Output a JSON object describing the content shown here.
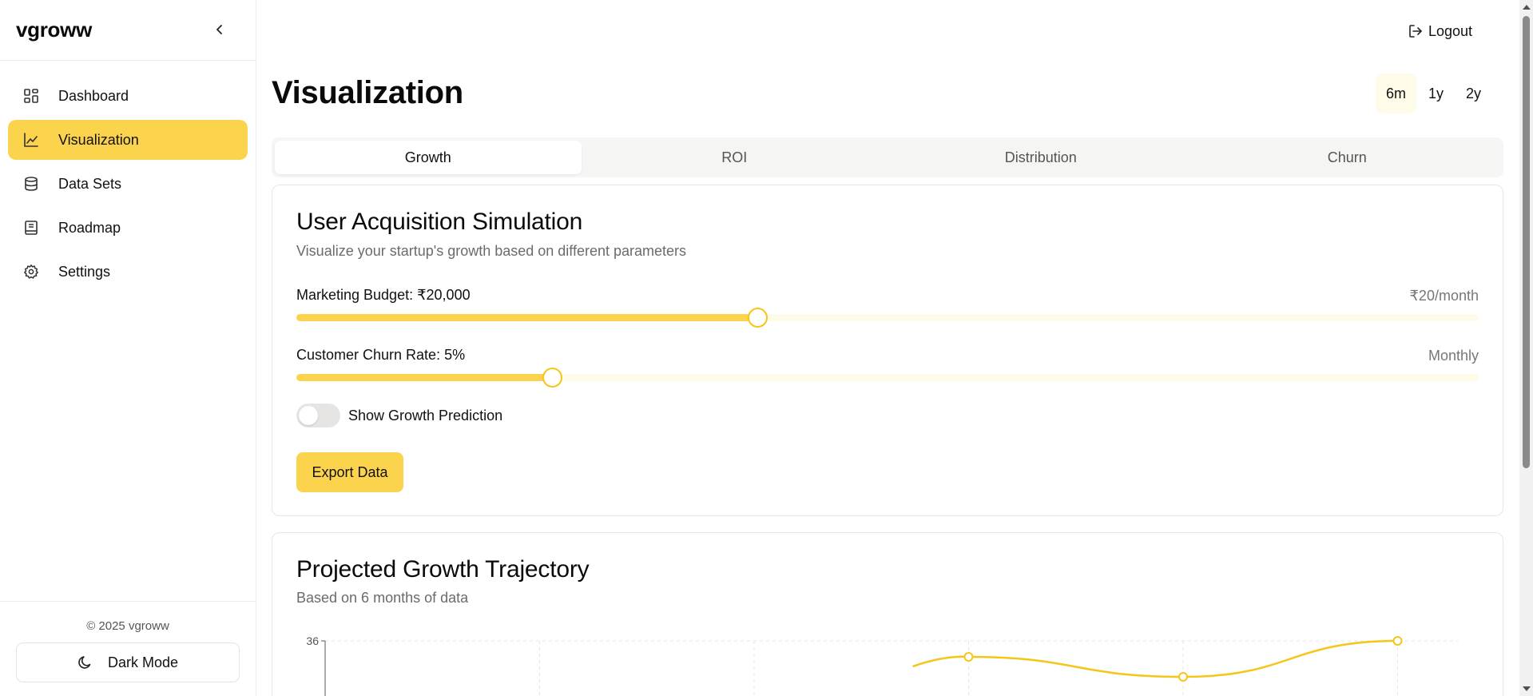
{
  "brand": "vgroww",
  "nav": [
    {
      "label": "Dashboard",
      "icon": "dashboard-grid-icon",
      "active": false
    },
    {
      "label": "Visualization",
      "icon": "line-chart-icon",
      "active": true
    },
    {
      "label": "Data Sets",
      "icon": "database-icon",
      "active": false
    },
    {
      "label": "Roadmap",
      "icon": "book-icon",
      "active": false
    },
    {
      "label": "Settings",
      "icon": "gear-icon",
      "active": false
    }
  ],
  "footer": {
    "copyright": "© 2025 vgroww",
    "dark_mode_label": "Dark Mode"
  },
  "header": {
    "logout_label": "Logout"
  },
  "page_title": "Visualization",
  "ranges": [
    {
      "label": "6m",
      "active": true
    },
    {
      "label": "1y",
      "active": false
    },
    {
      "label": "2y",
      "active": false
    }
  ],
  "tabs": [
    {
      "label": "Growth",
      "active": true
    },
    {
      "label": "ROI",
      "active": false
    },
    {
      "label": "Distribution",
      "active": false
    },
    {
      "label": "Churn",
      "active": false
    }
  ],
  "simulation": {
    "title": "User Acquisition Simulation",
    "subtitle": "Visualize your startup's growth based on different parameters",
    "budget_label": "Marketing Budget: ₹20,000",
    "budget_note": "₹20/month",
    "budget_fraction": 0.39,
    "churn_label": "Customer Churn Rate: 5%",
    "churn_note": "Monthly",
    "churn_fraction": 0.216,
    "toggle_label": "Show Growth Prediction",
    "toggle_on": false,
    "export_label": "Export Data"
  },
  "projection": {
    "title": "Projected Growth Trajectory",
    "subtitle": "Based on 6 months of data"
  },
  "colors": {
    "accent": "#fcd34d",
    "accent_dark": "#f5c518",
    "track": "#fefce8"
  },
  "chart_data": {
    "type": "line",
    "title": "",
    "xlabel": "",
    "ylabel": "",
    "y_ticks_visible": [
      "36"
    ],
    "ylim_max": 36,
    "grid": true,
    "series": [
      {
        "values": [
          null,
          null,
          null,
          32,
          27,
          36
        ]
      }
    ]
  }
}
